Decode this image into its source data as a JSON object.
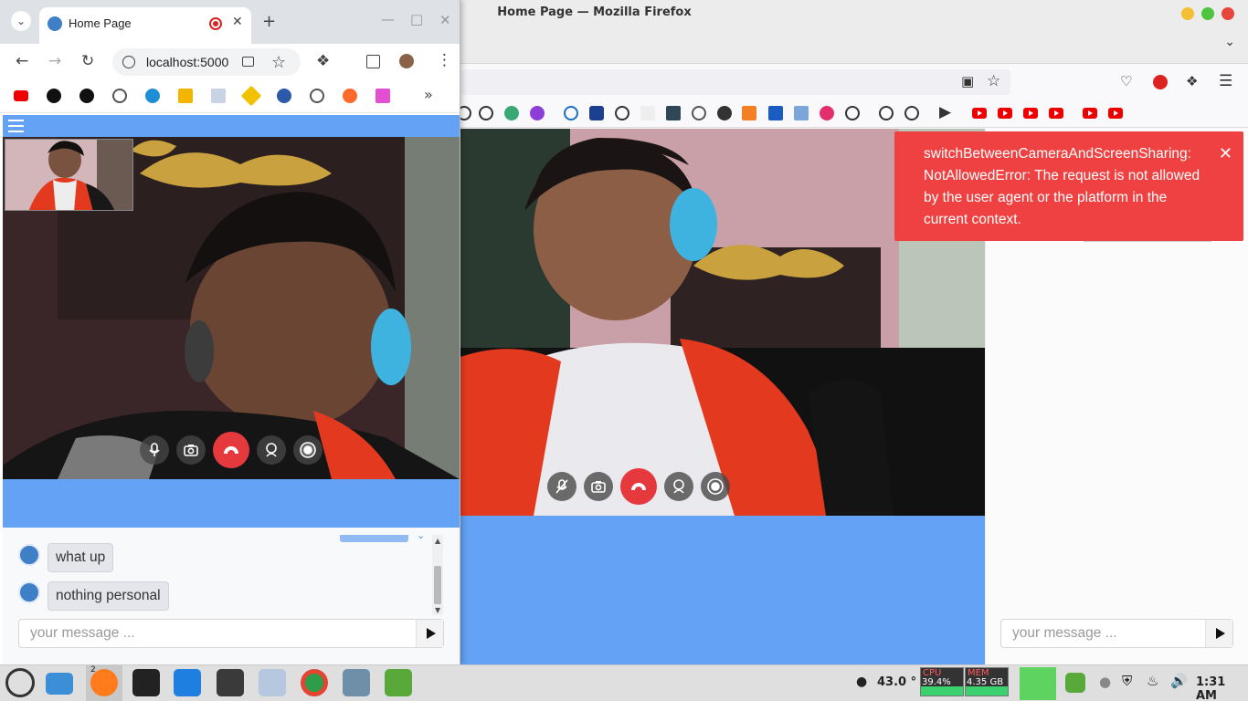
{
  "firefox": {
    "window_title": "Home Page — Mozilla Firefox",
    "toast": {
      "message": "switchBetweenCameraAndScreenSharing: NotAllowedError: The request is not allowed by the user agent or the platform in the current context."
    },
    "message_placeholder": "your message ..."
  },
  "chrome": {
    "tab_title": "Home Page",
    "url": "localhost:5000",
    "chat": {
      "messages": [
        {
          "text": "what up"
        },
        {
          "text": "nothing personal"
        }
      ],
      "message_placeholder": "your message ..."
    }
  },
  "taskbar": {
    "firefox_badge": "2",
    "temperature": "43.0 °",
    "cpu_label": "CPU",
    "cpu_value": "39.4%",
    "mem_label": "MEM",
    "mem_value": "4.35 GB",
    "clock": "1:31 AM"
  },
  "colors": {
    "page_blue": "#64a2f5",
    "toast_red": "#ef4141",
    "end_call_red": "#e5393e"
  }
}
